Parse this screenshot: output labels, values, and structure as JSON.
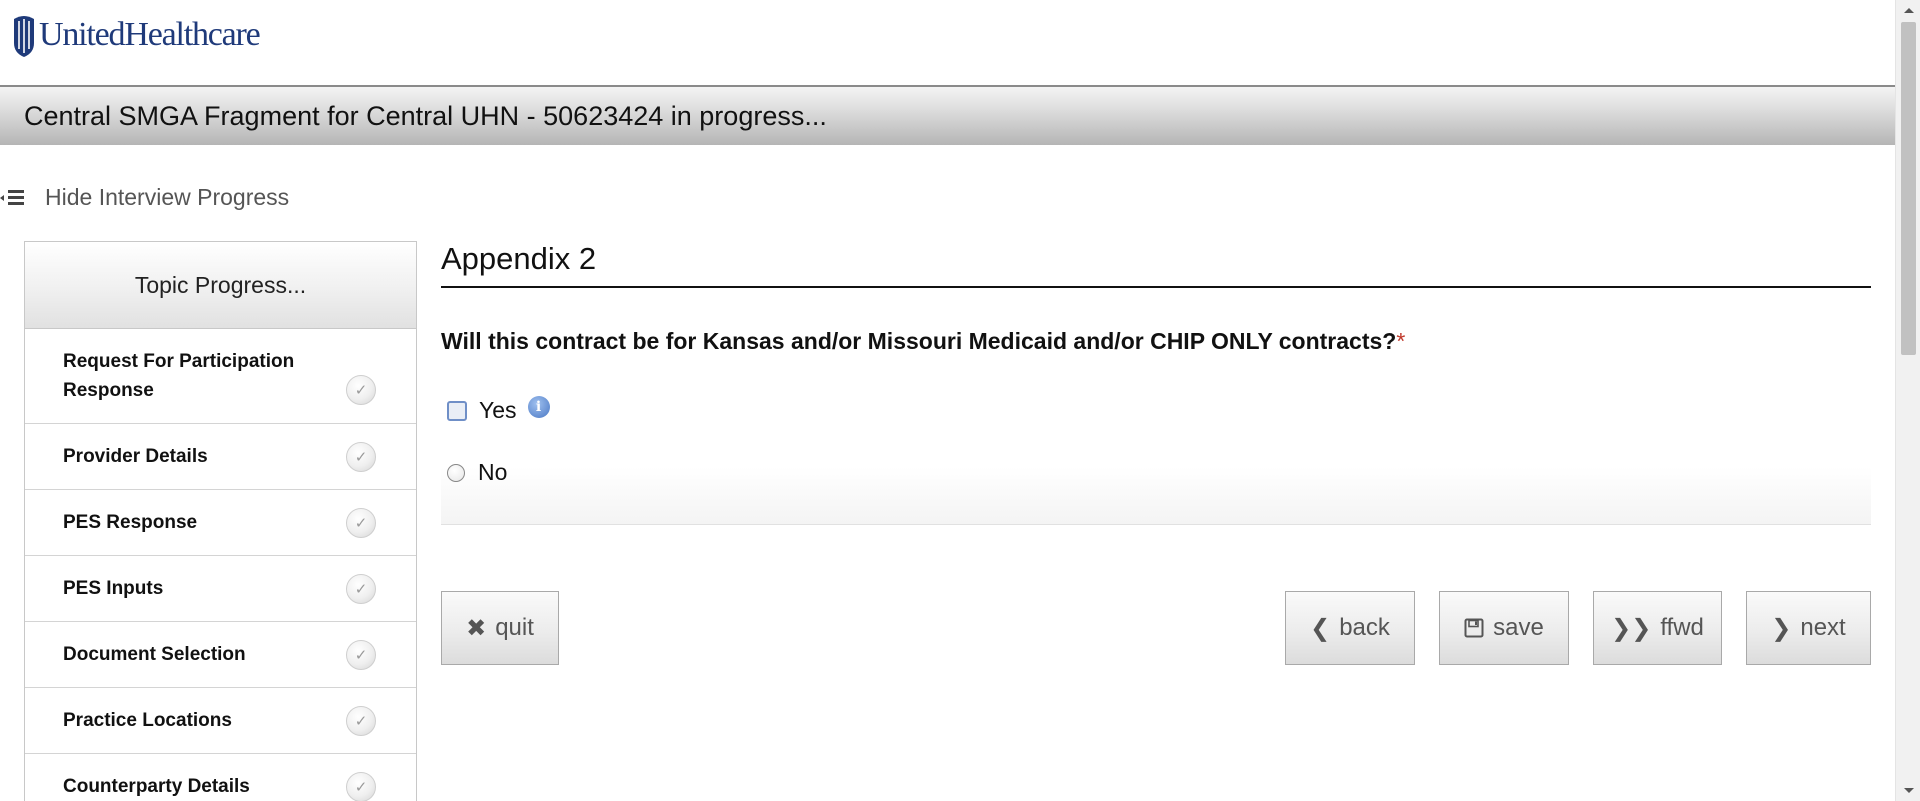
{
  "brand": {
    "name": "UnitedHealthcare",
    "color": "#1f3a7a"
  },
  "title_bar": {
    "text": "Central SMGA Fragment for Central UHN - 50623424 in progress..."
  },
  "progress_toggle": {
    "label": "Hide Interview Progress",
    "icon": "collapse-list-icon"
  },
  "sidebar": {
    "header": "Topic Progress...",
    "items": [
      {
        "label": "Request For Participation Response",
        "status": "complete",
        "icon": "check-icon"
      },
      {
        "label": "Provider Details",
        "status": "complete",
        "icon": "check-icon"
      },
      {
        "label": "PES Response",
        "status": "complete",
        "icon": "check-icon"
      },
      {
        "label": "PES Inputs",
        "status": "complete",
        "icon": "check-icon"
      },
      {
        "label": "Document Selection",
        "status": "complete",
        "icon": "check-icon"
      },
      {
        "label": "Practice Locations",
        "status": "complete",
        "icon": "check-icon"
      },
      {
        "label": "Counterparty Details",
        "status": "complete",
        "icon": "check-icon"
      }
    ]
  },
  "main": {
    "title": "Appendix 2",
    "question": "Will this contract be for Kansas and/or Missouri Medicaid and/or CHIP ONLY contracts?",
    "required_marker": "*",
    "options": [
      {
        "label": "Yes",
        "selected": false,
        "info": "i"
      },
      {
        "label": "No",
        "selected": false
      }
    ]
  },
  "buttons": {
    "quit": "quit",
    "back": "back",
    "save": "save",
    "ffwd": "ffwd",
    "next": "next"
  },
  "colors": {
    "required": "#c0392b",
    "info_icon": "#4a78c4",
    "checkbox_border": "#6f8fc7"
  }
}
